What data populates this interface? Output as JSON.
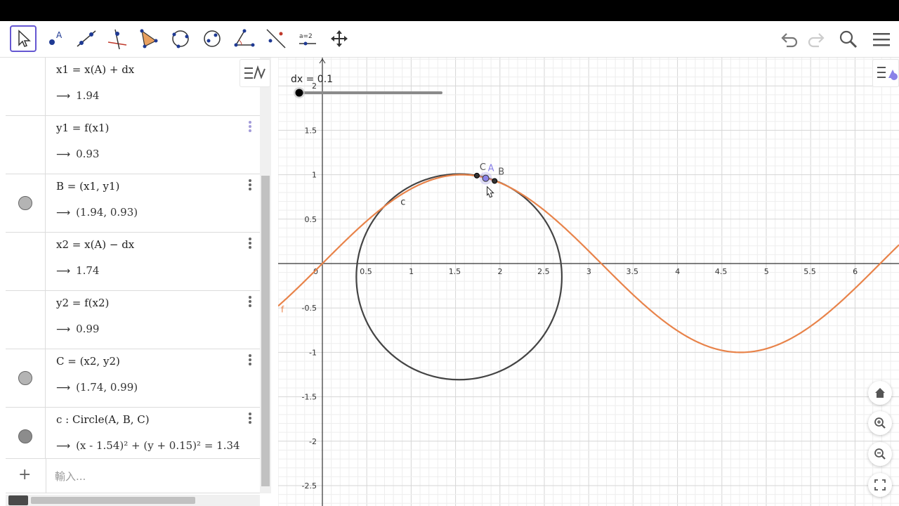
{
  "toolbar": {
    "tools": [
      {
        "name": "move-tool",
        "active": true
      },
      {
        "name": "point-tool",
        "active": false
      },
      {
        "name": "line-tool",
        "active": false
      },
      {
        "name": "perpendicular-tool",
        "active": false
      },
      {
        "name": "polygon-tool",
        "active": false
      },
      {
        "name": "circle-tool",
        "active": false
      },
      {
        "name": "ellipse-tool",
        "active": false
      },
      {
        "name": "angle-tool",
        "active": false
      },
      {
        "name": "reflect-tool",
        "active": false
      },
      {
        "name": "slider-tool",
        "label": "a=2",
        "active": false
      },
      {
        "name": "move-graphics-tool",
        "active": false
      }
    ],
    "right": [
      "undo-icon",
      "redo-icon",
      "search-icon",
      "menu-icon"
    ]
  },
  "algebra": {
    "rows": [
      {
        "definition": "x1 = x(A) + dx",
        "value": "1.94",
        "marble": "none",
        "menu": false
      },
      {
        "definition": "y1 = f(x1)",
        "value": "0.93",
        "marble": "none",
        "menu": true,
        "menu_light": true
      },
      {
        "definition": "B = (x1, y1)",
        "value": "(1.94, 0.93)",
        "marble": "light",
        "menu": true
      },
      {
        "definition": "x2 = x(A) − dx",
        "value": "1.74",
        "marble": "none",
        "menu": true
      },
      {
        "definition": "y2 = f(x2)",
        "value": "0.99",
        "marble": "none",
        "menu": true
      },
      {
        "definition": "C = (x2, y2)",
        "value": "(1.74, 0.99)",
        "marble": "light",
        "menu": true
      },
      {
        "definition": "c : Circle(A, B, C)",
        "value": "(x - 1.54)² + (y + 0.15)² = 1.34",
        "marble": "dark",
        "menu": true
      }
    ],
    "input_placeholder": "輸入..."
  },
  "graphics": {
    "slider_label": "dx = 0.1",
    "slider_value": 0.1,
    "x_ticks": [
      "0",
      "0.5",
      "1",
      "1.5",
      "2",
      "2.5",
      "3",
      "3.5",
      "4",
      "4.5",
      "5",
      "5.5",
      "6"
    ],
    "y_ticks": [
      "2",
      "1.5",
      "1",
      "0.5",
      "-0.5",
      "-1",
      "-1.5",
      "-2",
      "-2.5"
    ],
    "curve_label": "f",
    "circle_label": "c",
    "point_labels": [
      "C",
      "A",
      "B"
    ],
    "function": "sin(x)",
    "circle": {
      "cx": 1.54,
      "cy": -0.15,
      "r2": 1.34
    },
    "points": {
      "A": [
        1.84,
        0.96
      ],
      "B": [
        1.94,
        0.93
      ],
      "C": [
        1.74,
        0.99
      ]
    },
    "colors": {
      "curve": "#e8834a",
      "circle": "#444444",
      "point_A": "#8a82e8",
      "point": "#333333",
      "grid_minor": "#eeeeee",
      "grid_major": "#d6d6d6"
    }
  },
  "nav": [
    "home-icon",
    "zoom-in-icon",
    "zoom-out-icon",
    "fullscreen-icon"
  ]
}
